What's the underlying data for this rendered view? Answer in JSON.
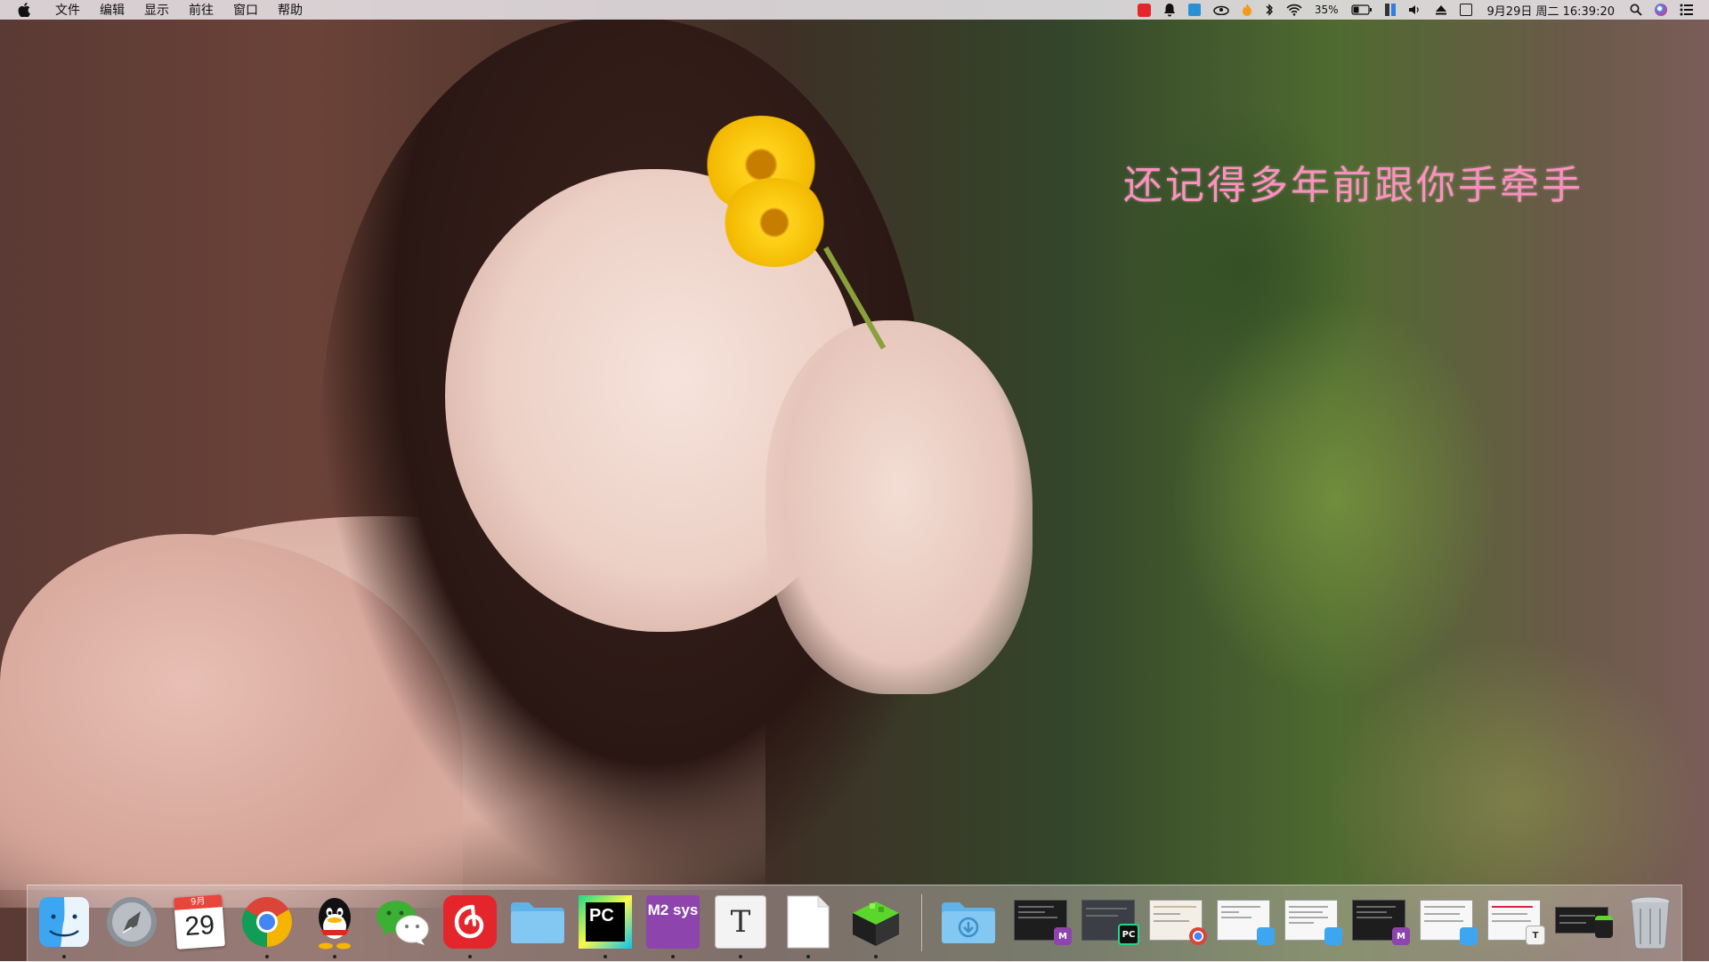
{
  "menubar": {
    "apple_icon": "apple-icon",
    "items": [
      "文件",
      "编辑",
      "显示",
      "前往",
      "窗口",
      "帮助"
    ],
    "status": {
      "battery_percent": "35%",
      "clock": "9月29日 周二 16:39:20"
    },
    "tray_icons": [
      "netease-music-icon",
      "qq-bell-icon",
      "translate-icon",
      "cloud-icon",
      "flame-icon",
      "bluetooth-icon",
      "wifi-icon",
      "battery-icon",
      "input-switch-icon",
      "volume-icon",
      "eject-icon",
      "ime-icon",
      "search-icon",
      "siri-icon",
      "notification-center-icon"
    ]
  },
  "wallpaper": {
    "caption": "还记得多年前跟你手牵手",
    "caption_color": "#ff8fbf"
  },
  "dock": {
    "apps": [
      {
        "name": "finder-icon",
        "running": true
      },
      {
        "name": "launchpad-icon",
        "running": false
      },
      {
        "name": "calendar-icon",
        "running": false,
        "month": "9月",
        "day": "29"
      },
      {
        "name": "chrome-icon",
        "running": true
      },
      {
        "name": "qq-icon",
        "running": true
      },
      {
        "name": "wechat-icon",
        "running": false
      },
      {
        "name": "netease-music-icon",
        "running": true
      },
      {
        "name": "folder-icon",
        "running": false
      },
      {
        "name": "pycharm-icon",
        "running": true,
        "label": "PC"
      },
      {
        "name": "msys2-icon",
        "running": true,
        "label": "M2 sys"
      },
      {
        "name": "typora-icon",
        "running": true,
        "label": "T"
      },
      {
        "name": "blank-document-icon",
        "running": true
      },
      {
        "name": "minecraft-block-icon",
        "running": true
      }
    ],
    "stacks": [
      {
        "name": "downloads-folder-icon"
      },
      {
        "name": "window-thumb-terminal",
        "badge": "M"
      },
      {
        "name": "window-thumb-pycharm",
        "badge": "PC"
      },
      {
        "name": "window-thumb-chrome",
        "badge": "chrome"
      },
      {
        "name": "window-thumb-finder-1",
        "badge": "finder"
      },
      {
        "name": "window-thumb-finder-2",
        "badge": "finder"
      },
      {
        "name": "window-thumb-msys",
        "badge": "M"
      },
      {
        "name": "window-thumb-finder-3",
        "badge": "finder"
      },
      {
        "name": "window-thumb-typora",
        "badge": "T"
      },
      {
        "name": "window-thumb-minecraft",
        "badge": "block"
      },
      {
        "name": "trash-icon"
      }
    ]
  }
}
